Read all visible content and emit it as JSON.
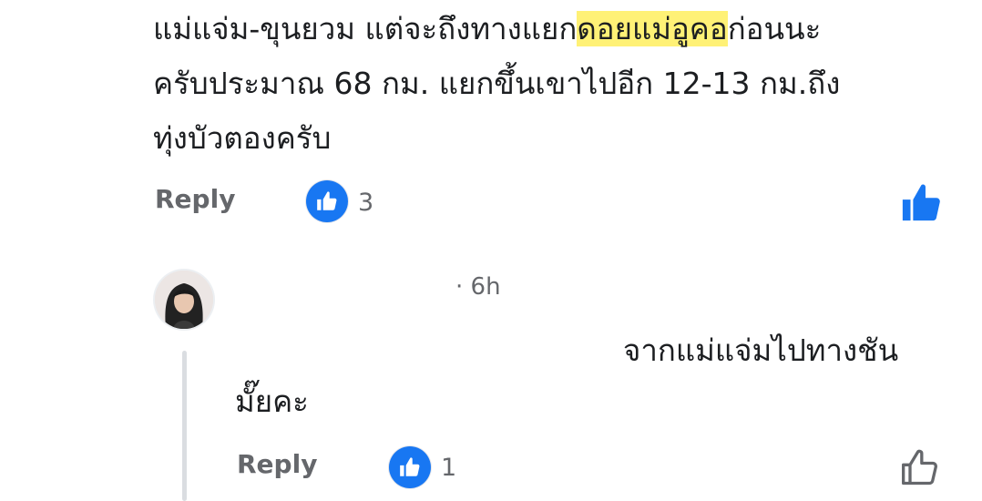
{
  "comment1": {
    "line1_before": "แม่แจ่ม-ขุนยวม แต่จะถึงทางแยก",
    "line1_highlight": "ดอยแม่อูคอ",
    "line1_after": "ก่อนนะ",
    "line2": "ครับประมาณ 68 กม. แยกขึ้นเขาไปอีก 12-13 กม.ถึง",
    "line3": "ทุ่งบัวตองครับ",
    "reply_label": "Reply",
    "reaction_count": "3",
    "highlight_color": "#fff176"
  },
  "comment2": {
    "time": "· 6h",
    "line1": "จากแม่แจ่มไปทางชัน",
    "line2": "มั๊ยคะ",
    "reply_label": "Reply",
    "reaction_count": "1"
  },
  "colors": {
    "like_blue": "#1877f2",
    "muted_text": "#65676b",
    "thread_line": "#dadde1"
  },
  "icons": [
    "thumbs-up-icon",
    "thumbs-up-filled-icon",
    "thumbs-up-outline-icon"
  ]
}
